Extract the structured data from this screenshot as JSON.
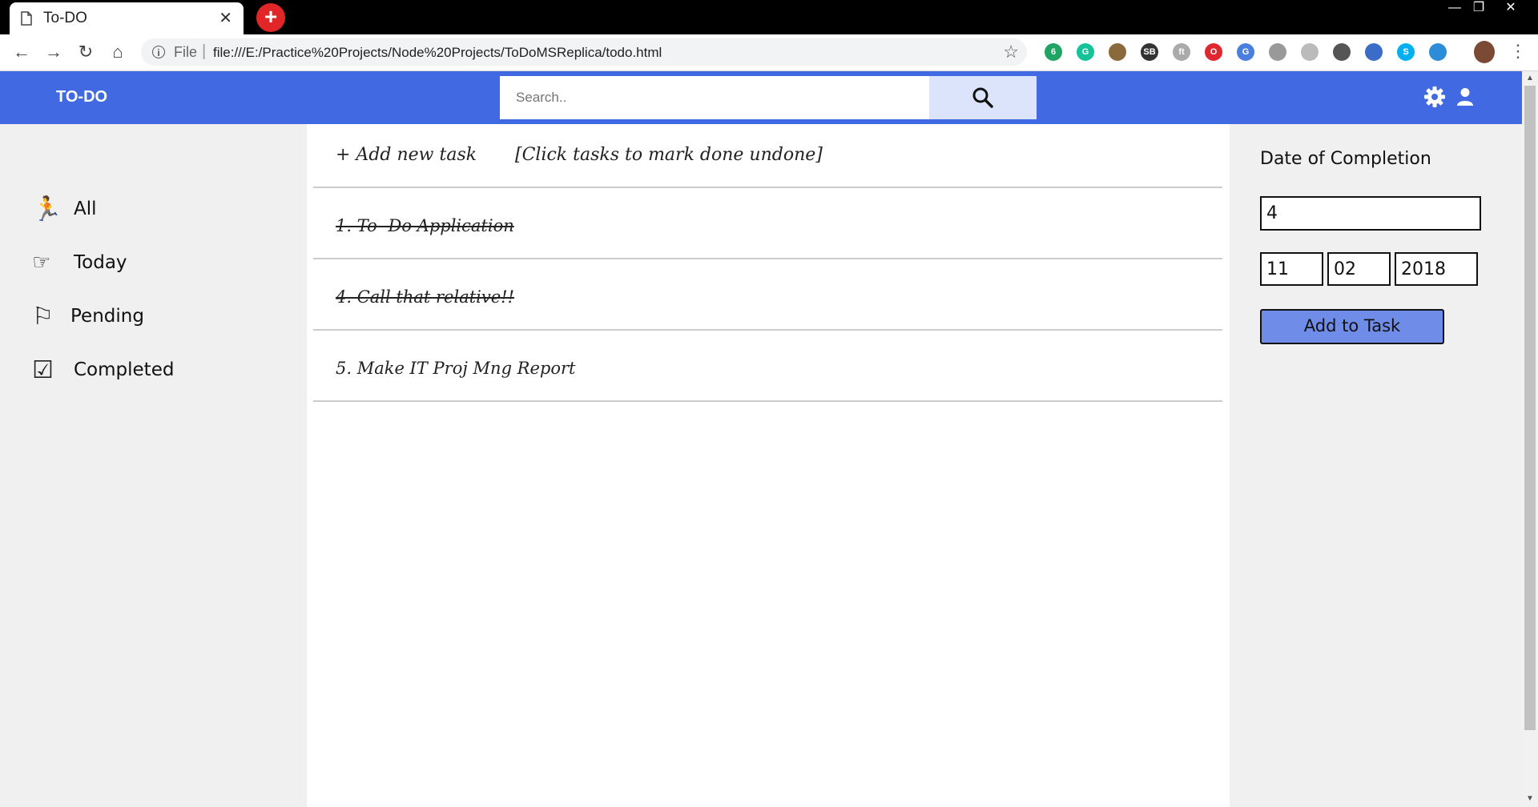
{
  "browser": {
    "tab_title": "To-DO",
    "tab_close": "✕",
    "new_tab": "+",
    "url_scheme": "File",
    "url_separator": "|",
    "url": "file:///E:/Practice%20Projects/Node%20Projects/ToDoMSReplica/todo.html",
    "nav": {
      "back": "←",
      "forward": "→",
      "reload": "↻",
      "home": "⌂"
    },
    "bookmark_icon": "☆",
    "menu_icon": "⋮",
    "window_controls": {
      "minimize": "—",
      "restore": "❐",
      "close": "✕"
    },
    "extensions": [
      {
        "name": "badge-extension-icon",
        "label": "6",
        "color": "#1fa463"
      },
      {
        "name": "grammarly-icon",
        "label": "G",
        "color": "#15c39a"
      },
      {
        "name": "plant-extension-icon",
        "label": "",
        "color": "#8a6a3a"
      },
      {
        "name": "sb-extension-icon",
        "label": "SB",
        "color": "#333333"
      },
      {
        "name": "font-extension-icon",
        "label": "ft",
        "color": "#aaaaaa"
      },
      {
        "name": "opera-icon",
        "label": "O",
        "color": "#e0262f"
      },
      {
        "name": "translate-icon",
        "label": "G",
        "color": "#4a7fe0"
      },
      {
        "name": "cube-extension-icon",
        "label": "",
        "color": "#999999"
      },
      {
        "name": "cloud-extension-icon",
        "label": "",
        "color": "#bbbbbb"
      },
      {
        "name": "cast-icon",
        "label": "",
        "color": "#555555"
      },
      {
        "name": "download-extension-icon",
        "label": "",
        "color": "#3a6cc8"
      },
      {
        "name": "skype-icon",
        "label": "S",
        "color": "#00aff0"
      },
      {
        "name": "globe-extension-icon",
        "label": "",
        "color": "#2d8cd8"
      }
    ]
  },
  "header": {
    "brand": "TO-DO",
    "search_placeholder": "Search..",
    "accent_color": "#4169e1"
  },
  "sidebar": {
    "items": [
      {
        "icon": "running-person-icon",
        "glyph": "🏃",
        "label": "All"
      },
      {
        "icon": "pointing-hand-icon",
        "glyph": "☞",
        "label": "Today"
      },
      {
        "icon": "flag-icon",
        "glyph": "⚐",
        "label": "Pending"
      },
      {
        "icon": "checkbox-icon",
        "glyph": "☑",
        "label": "Completed"
      }
    ]
  },
  "main": {
    "add_task": "+ Add new task",
    "hint": "[Click tasks to mark done undone]",
    "tasks": [
      {
        "text": "1. To -Do Application",
        "done": true
      },
      {
        "text": "4. Call that relative!!",
        "done": true
      },
      {
        "text": "5. Make IT Proj Mng Report",
        "done": false
      }
    ]
  },
  "right_panel": {
    "title": "Date of Completion",
    "task_id": "4",
    "day": "11",
    "month": "02",
    "year": "2018",
    "add_button": "Add to Task",
    "button_color": "#6f8ce8"
  }
}
